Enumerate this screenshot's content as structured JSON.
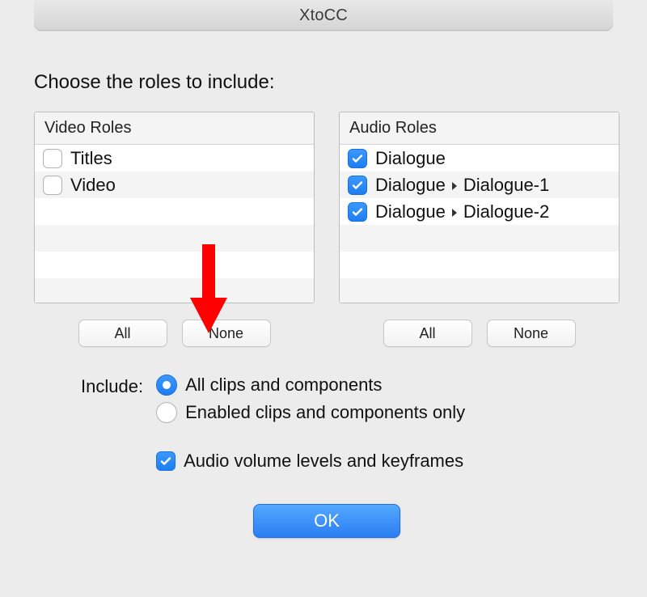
{
  "window": {
    "title": "XtoCC"
  },
  "heading": "Choose the roles to include:",
  "video": {
    "header": "Video Roles",
    "items": [
      {
        "label": "Titles",
        "checked": false
      },
      {
        "label": "Video",
        "checked": false
      }
    ]
  },
  "audio": {
    "header": "Audio Roles",
    "items": [
      {
        "label": "Dialogue",
        "checked": true
      },
      {
        "label_pre": "Dialogue",
        "label_post": "Dialogue-1",
        "checked": true,
        "nested": true
      },
      {
        "label_pre": "Dialogue",
        "label_post": "Dialogue-2",
        "checked": true,
        "nested": true
      }
    ]
  },
  "buttons": {
    "all": "All",
    "none": "None"
  },
  "include": {
    "label": "Include:",
    "option_all": "All clips and components",
    "option_enabled": "Enabled clips and components only",
    "option_audio_kf": "Audio volume levels and keyframes",
    "selected": "all",
    "audio_kf_checked": true
  },
  "ok": "OK"
}
